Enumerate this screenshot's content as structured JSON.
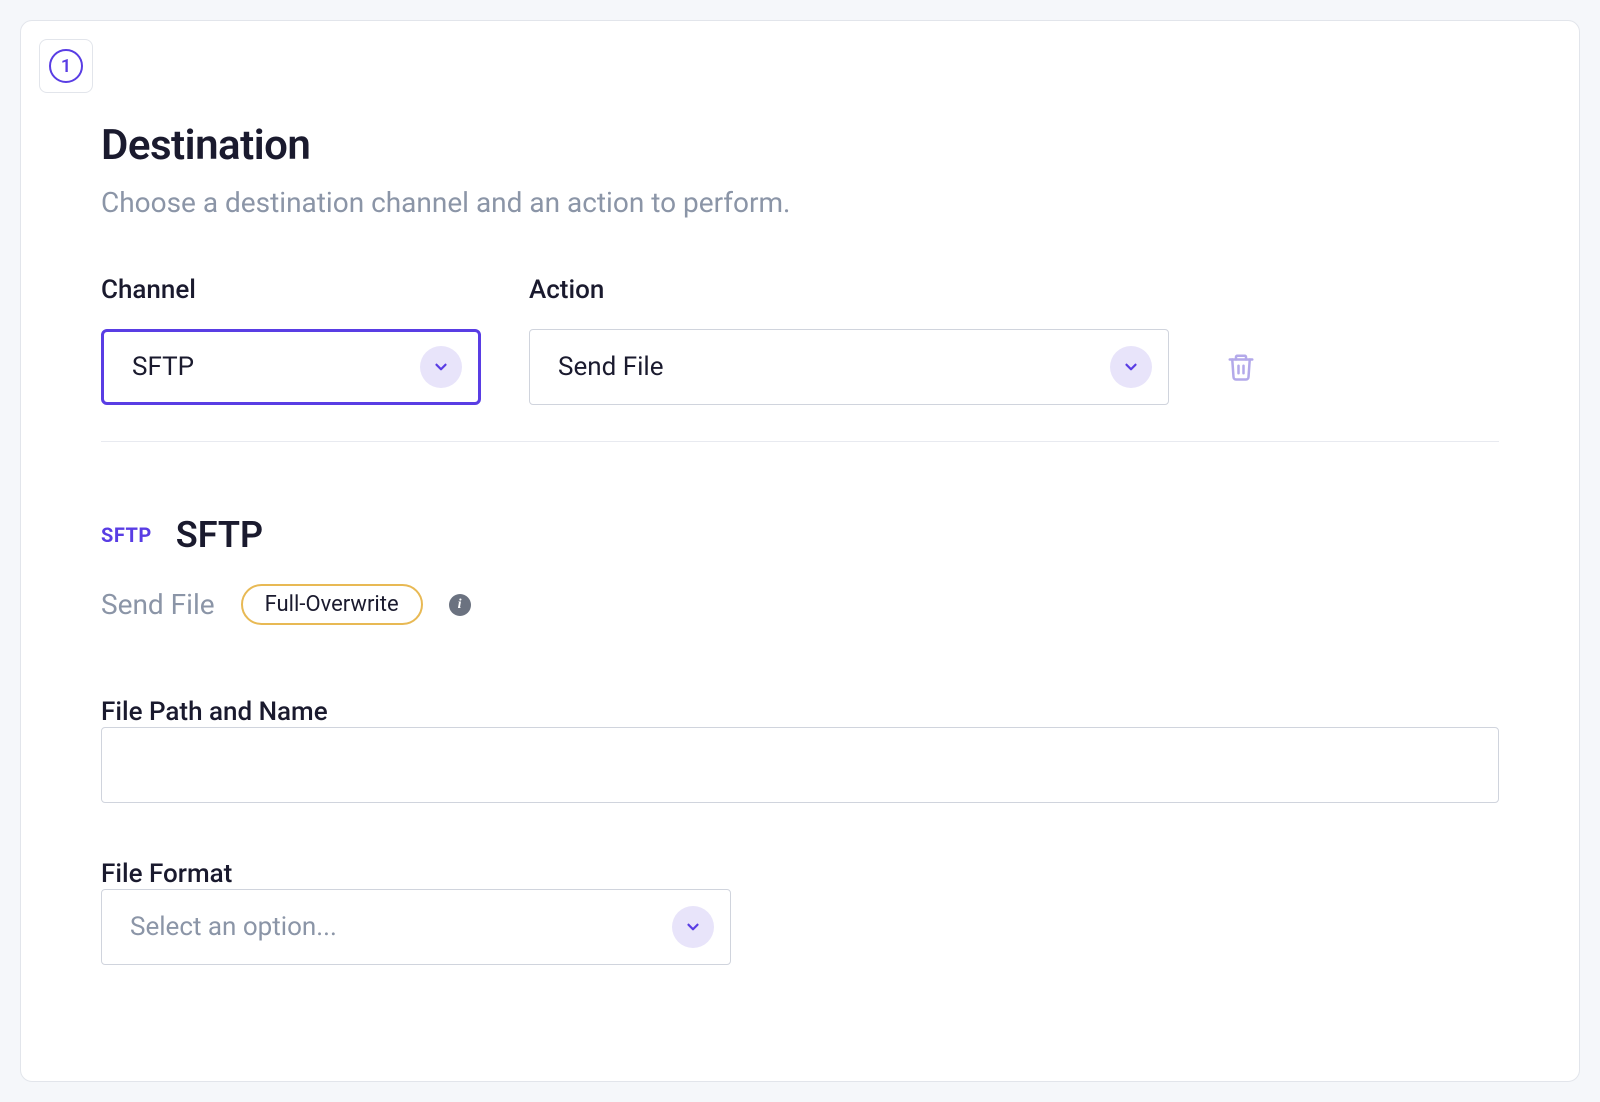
{
  "step": {
    "number": "1"
  },
  "destination": {
    "title": "Destination",
    "subtitle": "Choose a destination channel and an action to perform.",
    "channel": {
      "label": "Channel",
      "value": "SFTP"
    },
    "action": {
      "label": "Action",
      "value": "Send File"
    }
  },
  "protocol": {
    "badge": "SFTP",
    "title": "SFTP",
    "action": "Send File",
    "mode": "Full-Overwrite"
  },
  "filepath": {
    "label": "File Path and Name",
    "value": ""
  },
  "format": {
    "label": "File Format",
    "placeholder": "Select an option..."
  }
}
